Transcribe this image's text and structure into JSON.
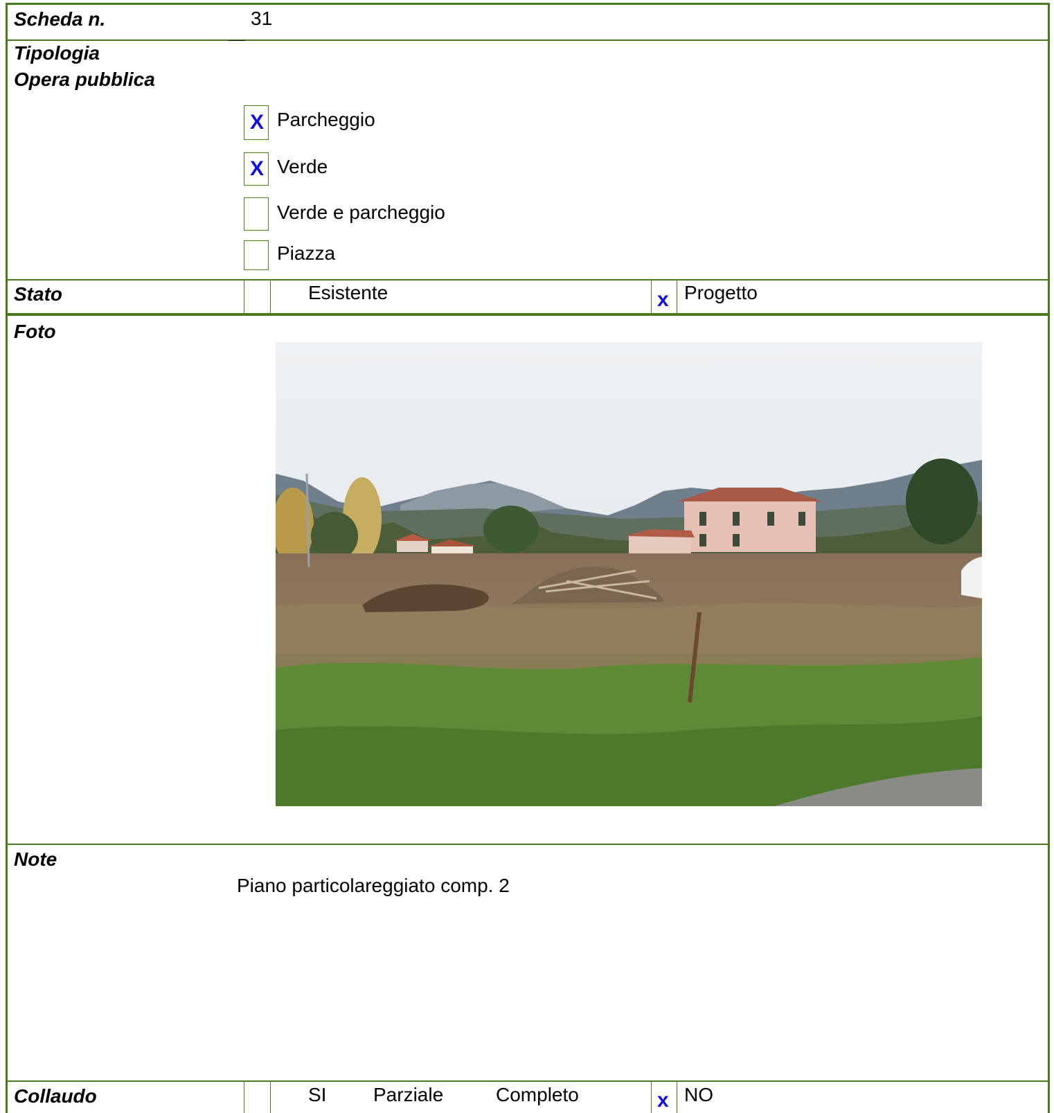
{
  "scheda": {
    "label": "Scheda n.",
    "value": "31"
  },
  "tipologia": {
    "label_line1": "Tipologia",
    "label_line2": "Opera pubblica",
    "options": [
      {
        "label": "Parcheggio",
        "checked": true
      },
      {
        "label": "Verde",
        "checked": true
      },
      {
        "label": "Verde e parcheggio",
        "checked": false
      },
      {
        "label": "Piazza",
        "checked": false
      }
    ],
    "check_mark": "X"
  },
  "stato": {
    "label": "Stato",
    "option1": "Esistente",
    "option1_checked": false,
    "option2": "Progetto",
    "option2_checked": true,
    "check_mark": "x"
  },
  "foto": {
    "label": "Foto"
  },
  "note": {
    "label": "Note",
    "text": "Piano particolareggiato comp. 2"
  },
  "collaudo": {
    "label": "Collaudo",
    "option_si": "SI",
    "option_parziale": "Parziale",
    "option_completo": "Completo",
    "option_no": "NO",
    "no_checked": true,
    "check_mark": "x"
  },
  "colors": {
    "border": "#4a7a1e",
    "check": "#1010e0"
  }
}
